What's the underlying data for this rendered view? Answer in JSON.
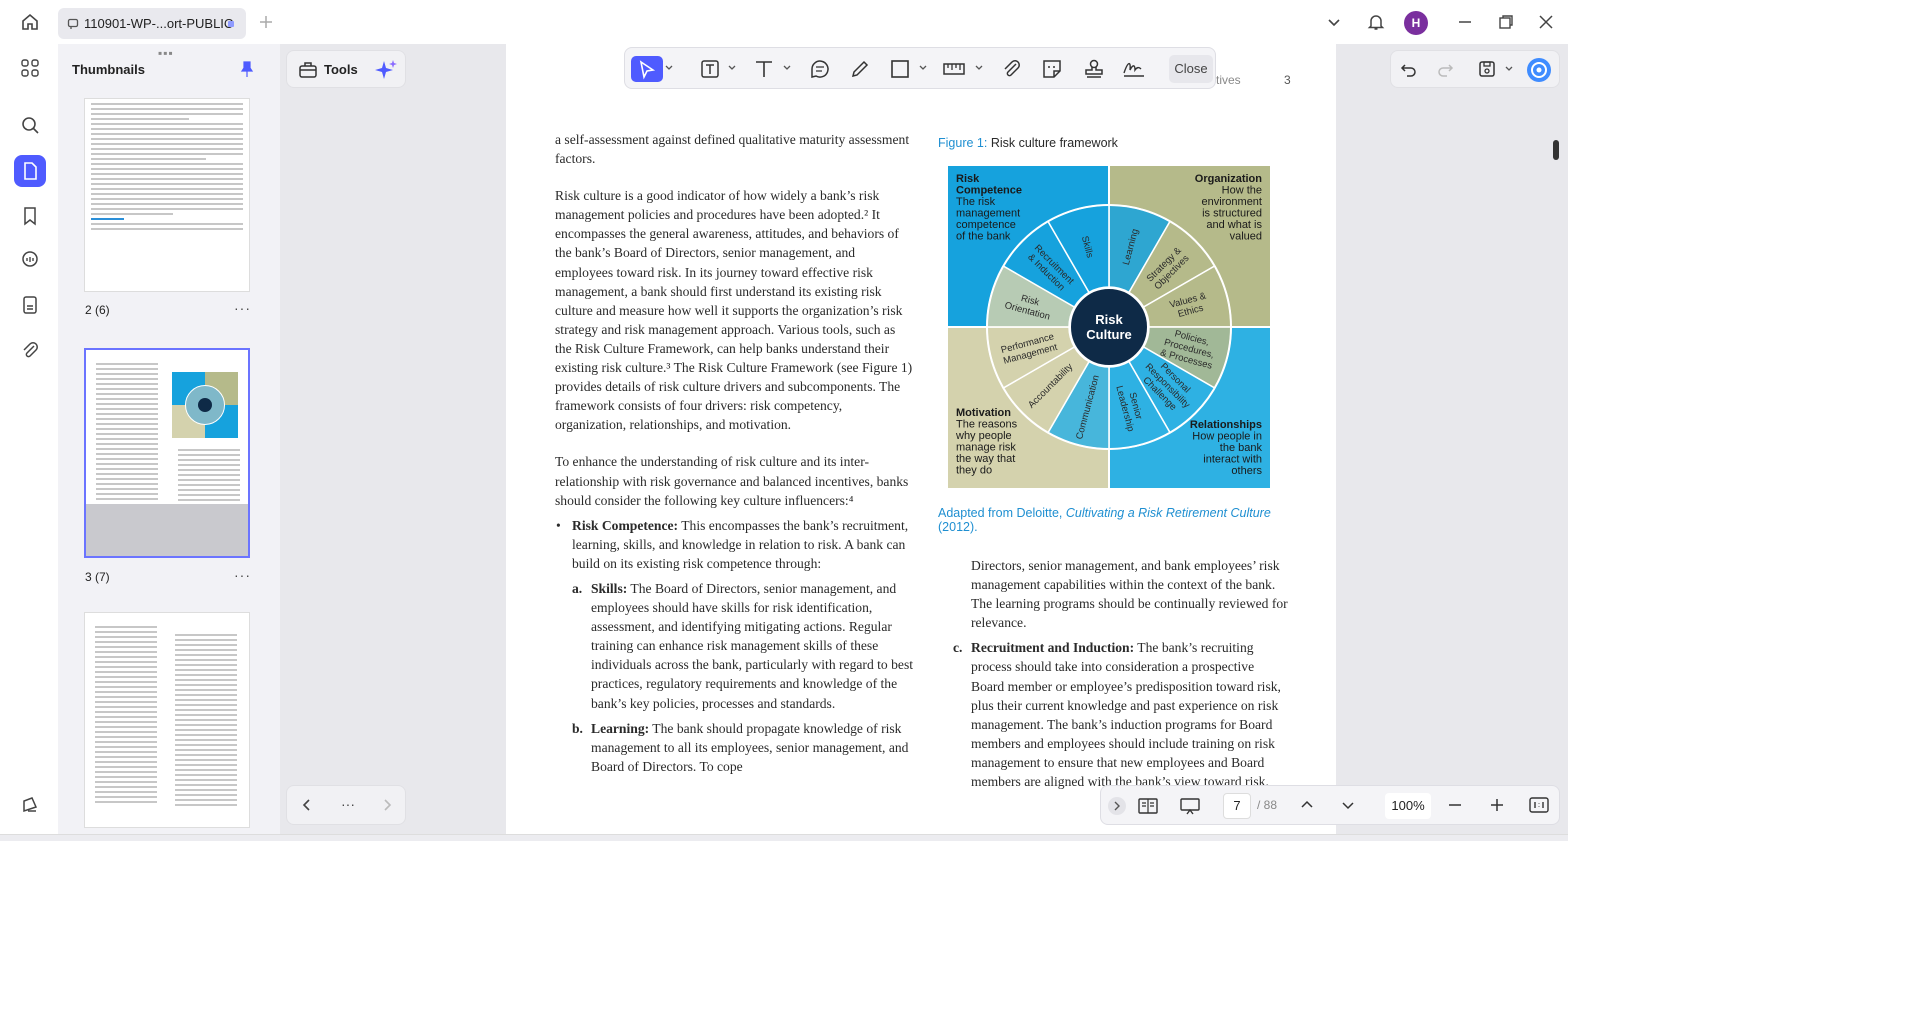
{
  "titlebar": {
    "tab_title": "110901-WP-...ort-PUBLIC",
    "avatar_initial": "H",
    "icons": [
      "home-icon",
      "page-icon",
      "add-tab-icon",
      "chevron-down-icon",
      "bell-icon",
      "minimize-icon",
      "maximize-icon",
      "close-icon"
    ]
  },
  "leftrail": {
    "icons": [
      "apps-icon",
      "search-icon",
      "pages-icon",
      "bookmark-icon",
      "comments-icon",
      "document-icon",
      "attachment-icon",
      "settings-icon"
    ],
    "active": "pages-icon"
  },
  "thumbnails": {
    "title": "Thumbnails",
    "pages": [
      {
        "label": "2 (6)"
      },
      {
        "label": "3 (7)",
        "selected": true
      },
      {
        "label": ""
      }
    ]
  },
  "tools": {
    "label": "Tools"
  },
  "annotation_toolbar": {
    "tools": [
      "select-icon",
      "textbox-icon",
      "text-icon",
      "comment-icon",
      "highlighter-icon",
      "shape-icon",
      "measure-icon",
      "attach-icon",
      "sticker-icon",
      "stamp-icon",
      "signature-icon"
    ],
    "close_label": "Close"
  },
  "page_header": {
    "text": "tives",
    "number": "3"
  },
  "document": {
    "col1_p1": "a self-assessment against defined qualitative maturity assessment factors.",
    "col1_p2": "Risk culture is a good indicator of how widely a bank’s risk management policies and procedures have been adopted.² It encompasses the general awareness, attitudes, and behaviors of the bank’s Board of Directors, senior management, and employees toward risk. In its journey toward effective risk management, a bank should first understand its existing risk culture and measure how well it supports the organization’s risk strategy and risk management approach. Various tools, such as the Risk Culture Framework, can help banks understand their existing risk culture.³ The Risk Culture Framework (see Figure 1) provides details of risk culture drivers and subcomponents. The framework consists of four drivers: risk competency, organization, relationships, and motivation.",
    "col1_p3": "To enhance the understanding of risk culture and its inter-relationship with risk governance and balanced incentives, banks should consider the following key culture influencers:⁴",
    "bullet1_title": "Risk Competence:",
    "bullet1_text": " This encompasses the bank’s recruitment, learning, skills, and knowledge in relation to risk. A bank can build on its existing risk competence through:",
    "item_a_marker": "a.",
    "item_a_title": "Skills:",
    "item_a_text": " The Board of Directors, senior management, and employees should have skills for risk identification, assessment, and identifying mitigating actions. Regular training can enhance risk management skills of these individuals across the bank, particularly with regard to best practices, regulatory requirements and knowledge of the bank’s key policies, processes and standards.",
    "item_b_marker": "b.",
    "item_b_title": "Learning:",
    "item_b_text": " The bank should propagate knowledge of risk management to all its employees, senior management, and Board of Directors. To cope",
    "figure_label": "Figure 1:",
    "figure_title": " Risk culture framework",
    "caption_prefix": "Adapted from Deloitte, ",
    "caption_italic": "Cultivating a Risk Retirement Culture",
    "caption_suffix": " (2012).",
    "col2_p1": "Directors, senior management, and bank employees’ risk management capabilities within the context of the bank. The learning programs should be continually reviewed for relevance.",
    "item_c_marker": "c.",
    "item_c_title": "Recruitment and Induction:",
    "item_c_text": " The bank’s recruiting process should take into consideration a prospective Board member or employee’s predisposition toward risk, plus their current knowledge and past experience on risk management. The bank’s induction programs for Board members and employees should include training on risk management to ensure that new employees and Board members are aligned with the bank’s view toward risk."
  },
  "figure": {
    "center": [
      "Risk",
      "Culture"
    ],
    "quadrants": {
      "tl_title": [
        "Risk",
        "Competence"
      ],
      "tl_text": [
        "The risk",
        "management",
        "competence",
        "of the bank"
      ],
      "tr_title": [
        "Organization"
      ],
      "tr_text": [
        "How the",
        "environment",
        "is structured",
        "and what is",
        "valued"
      ],
      "bl_title": [
        "Motivation"
      ],
      "bl_text": [
        "The reasons",
        "why people",
        "manage risk",
        "the way that",
        "they do"
      ],
      "br_title": [
        "Relationships"
      ],
      "br_text": [
        "How people in",
        "the bank",
        "interact with",
        "others"
      ]
    },
    "segments": [
      "Learning",
      "Strategy & Objectives",
      "Values & Ethics",
      "Policies, Procedures, & Processes",
      "Personal Responsibility Challenge",
      "Senior Leadership",
      "Communication",
      "Accountability",
      "Performance Management",
      "Risk Orientation",
      "Recruitment & Induction",
      "Skills"
    ],
    "colors": {
      "blue": "#16a2dd",
      "olive": "#b5ba8a",
      "lightblue": "#2eb1e3",
      "beige": "#d4d2ad",
      "center": "#0e2a47"
    }
  },
  "bottom_bar": {
    "current_page": "7",
    "total_pages": "/ 88",
    "zoom": "100%"
  }
}
